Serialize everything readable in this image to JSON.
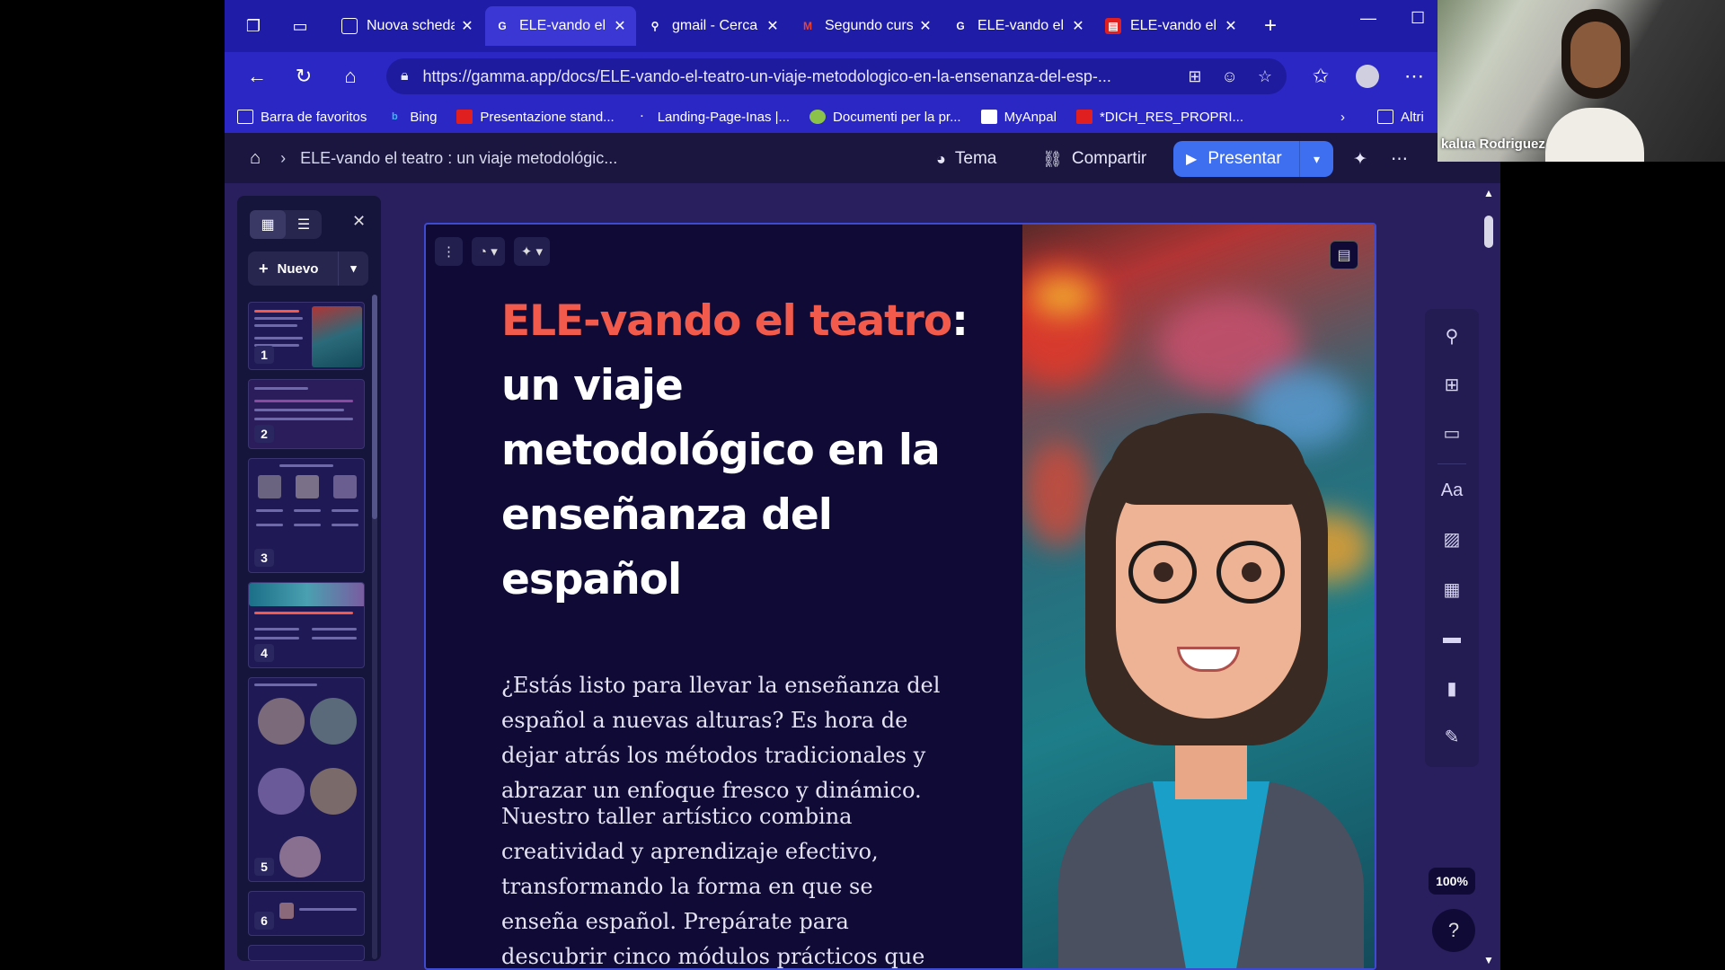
{
  "browser": {
    "tabs": [
      {
        "label": "Nuova scheda",
        "favicon": "newtab-icon",
        "active": false
      },
      {
        "label": "ELE-vando el",
        "favicon": "gamma-icon",
        "active": true
      },
      {
        "label": "gmail - Cerca",
        "favicon": "search-icon",
        "active": false
      },
      {
        "label": "Segundo curs",
        "favicon": "gmail-icon",
        "active": false
      },
      {
        "label": "ELE-vando el",
        "favicon": "gamma-icon",
        "active": false
      },
      {
        "label": "ELE-vando el",
        "favicon": "pdf-icon",
        "active": false
      }
    ],
    "url": "https://gamma.app/docs/ELE-vando-el-teatro-un-viaje-metodologico-en-la-ensenanza-del-esp-...",
    "favorites": [
      {
        "label": "Barra de favoritos"
      },
      {
        "label": "Bing"
      },
      {
        "label": "Presentazione stand..."
      },
      {
        "label": "Landing-Page-Inas |..."
      },
      {
        "label": "Documenti per la pr..."
      },
      {
        "label": "MyAnpal"
      },
      {
        "label": "*DICH_RES_PROPRI..."
      }
    ],
    "favorites_more": "Altri"
  },
  "app": {
    "breadcrumb": "ELE-vando el teatro : un viaje metodológic...",
    "theme_label": "Tema",
    "share_label": "Compartir",
    "present_label": "Presentar"
  },
  "sidebar": {
    "new_label": "Nuevo",
    "thumbnails": [
      {
        "number": "1"
      },
      {
        "number": "2"
      },
      {
        "number": "3"
      },
      {
        "number": "4"
      },
      {
        "number": "5"
      },
      {
        "number": "6"
      }
    ]
  },
  "slide": {
    "title_highlight": "ELE-vando el teatro",
    "title_rest": ": un viaje metodológico en la enseñanza del español",
    "paragraph1": "¿Estás listo para llevar la enseñanza del español a nuevas alturas? Es hora de dejar atrás los métodos tradicionales y abrazar un enfoque fresco y dinámico.",
    "paragraph2": "Nuestro taller artístico combina creatividad y aprendizaje efectivo, transformando la forma en que se enseña español. Prepárate para descubrir cinco módulos prácticos que puedes aplicar"
  },
  "zoom": "100%",
  "help": "?",
  "webcam": {
    "name": "kalua Rodriguez"
  },
  "colors": {
    "accent": "#f25a4c",
    "present_button": "#3e6ff0",
    "browser_chrome": "#2a27c4",
    "slide_bg": "#0f0b36"
  }
}
